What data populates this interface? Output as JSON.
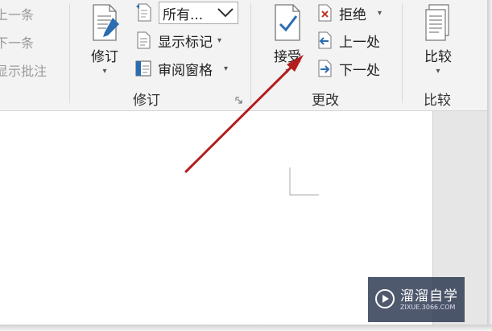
{
  "left_cut": {
    "item1": "上一条",
    "item2": "下一条",
    "item3": "显示批注"
  },
  "tracking": {
    "track_label": "修订",
    "dropdown_value": "所有...",
    "show_markup": "显示标记",
    "review_pane": "审阅窗格",
    "group_title": "修订"
  },
  "changes": {
    "accept_label": "接受",
    "reject_label": "拒绝",
    "previous_label": "上一处",
    "next_label": "下一处",
    "group_title": "更改"
  },
  "compare": {
    "compare_label": "比较",
    "group_title": "比较"
  },
  "watermark": {
    "title": "溜溜自学",
    "subtitle": "ZIXUE.3066.COM"
  },
  "colors": {
    "arrow": "#b41e1e",
    "accent_blue": "#2b6cb0",
    "ribbon_bg": "#f3f3f3"
  }
}
